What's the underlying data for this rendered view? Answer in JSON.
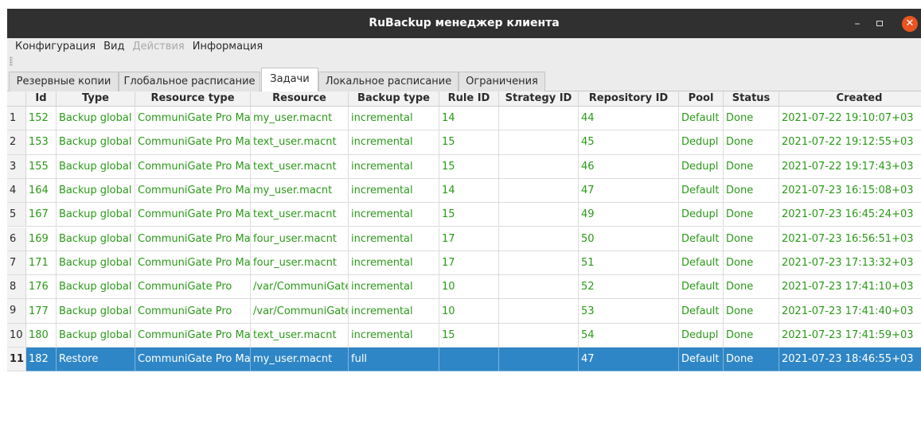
{
  "window": {
    "title": "RuBackup менеджер клиента",
    "minimize": "–",
    "close": "✕"
  },
  "menu": [
    {
      "label": "Конфигурация",
      "enabled": true
    },
    {
      "label": "Вид",
      "enabled": true
    },
    {
      "label": "Действия",
      "enabled": false
    },
    {
      "label": "Информация",
      "enabled": true
    }
  ],
  "tabs": [
    {
      "label": "Резервные копии",
      "active": false
    },
    {
      "label": "Глобальное расписание",
      "active": false
    },
    {
      "label": "Задачи",
      "active": true
    },
    {
      "label": "Локальное расписание",
      "active": false
    },
    {
      "label": "Ограничения",
      "active": false
    }
  ],
  "table": {
    "columns": [
      "Id",
      "Type",
      "Resource type",
      "Resource",
      "Backup type",
      "Rule ID",
      "Strategy ID",
      "Repository ID",
      "Pool",
      "Status",
      "Created"
    ],
    "rows": [
      {
        "n": "1",
        "cells": [
          "152",
          "Backup global",
          "CommuniGate Pro Mail",
          "my_user.macnt",
          "incremental",
          "14",
          "",
          "44",
          "Default",
          "Done",
          "2021-07-22 19:10:07+03"
        ]
      },
      {
        "n": "2",
        "cells": [
          "153",
          "Backup global",
          "CommuniGate Pro Mail",
          "text_user.macnt",
          "incremental",
          "15",
          "",
          "45",
          "Dedupl",
          "Done",
          "2021-07-22 19:12:55+03"
        ]
      },
      {
        "n": "3",
        "cells": [
          "155",
          "Backup global",
          "CommuniGate Pro Mail",
          "text_user.macnt",
          "incremental",
          "15",
          "",
          "46",
          "Dedupl",
          "Done",
          "2021-07-22 19:17:43+03"
        ]
      },
      {
        "n": "4",
        "cells": [
          "164",
          "Backup global",
          "CommuniGate Pro Mail",
          "my_user.macnt",
          "incremental",
          "14",
          "",
          "47",
          "Default",
          "Done",
          "2021-07-23 16:15:08+03"
        ]
      },
      {
        "n": "5",
        "cells": [
          "167",
          "Backup global",
          "CommuniGate Pro Mail",
          "text_user.macnt",
          "incremental",
          "15",
          "",
          "49",
          "Dedupl",
          "Done",
          "2021-07-23 16:45:24+03"
        ]
      },
      {
        "n": "6",
        "cells": [
          "169",
          "Backup global",
          "CommuniGate Pro Mail",
          "four_user.macnt",
          "incremental",
          "17",
          "",
          "50",
          "Default",
          "Done",
          "2021-07-23 16:56:51+03"
        ]
      },
      {
        "n": "7",
        "cells": [
          "171",
          "Backup global",
          "CommuniGate Pro Mail",
          "four_user.macnt",
          "incremental",
          "17",
          "",
          "51",
          "Default",
          "Done",
          "2021-07-23 17:13:32+03"
        ]
      },
      {
        "n": "8",
        "cells": [
          "176",
          "Backup global",
          "CommuniGate Pro",
          "/var/CommuniGate",
          "incremental",
          "10",
          "",
          "52",
          "Default",
          "Done",
          "2021-07-23 17:41:10+03"
        ]
      },
      {
        "n": "9",
        "cells": [
          "177",
          "Backup global",
          "CommuniGate Pro",
          "/var/CommuniGate",
          "incremental",
          "10",
          "",
          "53",
          "Default",
          "Done",
          "2021-07-23 17:41:40+03"
        ]
      },
      {
        "n": "10",
        "cells": [
          "180",
          "Backup global",
          "CommuniGate Pro Mail",
          "text_user.macnt",
          "incremental",
          "15",
          "",
          "54",
          "Dedupl",
          "Done",
          "2021-07-23 17:41:59+03"
        ]
      },
      {
        "n": "11",
        "cells": [
          "182",
          "Restore",
          "CommuniGate Pro Mail",
          "my_user.macnt",
          "full",
          "",
          "",
          "47",
          "Default",
          "Done",
          "2021-07-23 18:46:55+03"
        ]
      }
    ],
    "selected_row": 11
  },
  "colors": {
    "title_bar": "#303030",
    "close_button": "#e95420",
    "row_text": "#2a9a18",
    "selection": "#2f86c6"
  }
}
